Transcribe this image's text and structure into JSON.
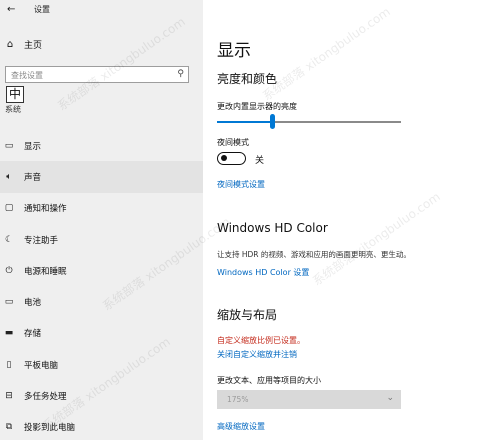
{
  "window": {
    "title": "设置",
    "back_icon": "back-arrow-icon"
  },
  "sidebar": {
    "home_label": "主页",
    "search_placeholder": "查找设置",
    "ime_indicator": "中",
    "section_caption": "系统",
    "items": [
      {
        "label": "显示",
        "icon": "monitor-icon"
      },
      {
        "label": "声音",
        "icon": "speaker-icon",
        "selected": true
      },
      {
        "label": "通知和操作",
        "icon": "notification-icon"
      },
      {
        "label": "专注助手",
        "icon": "moon-icon"
      },
      {
        "label": "电源和睡眠",
        "icon": "power-icon"
      },
      {
        "label": "电池",
        "icon": "battery-icon"
      },
      {
        "label": "存储",
        "icon": "storage-icon"
      },
      {
        "label": "平板电脑",
        "icon": "tablet-icon"
      },
      {
        "label": "多任务处理",
        "icon": "multitask-icon"
      },
      {
        "label": "投影到此电脑",
        "icon": "project-icon"
      }
    ]
  },
  "main": {
    "title": "显示",
    "brightness_section": "亮度和颜色",
    "brightness_label": "更改内置显示器的亮度",
    "brightness_level": 0.3,
    "night_label": "夜间模式",
    "night_toggle_state": "关",
    "night_settings_link": "夜间模式设置",
    "hdr_title": "Windows HD Color",
    "hdr_desc": "让支持 HDR 的视频、游戏和应用的画面更明亮、更生动。",
    "hdr_link": "Windows HD Color 设置",
    "scale_section": "缩放与布局",
    "custom_scale_warning": "自定义缩放比例已设置。",
    "turn_off_custom_link": "关闭自定义缩放并注销",
    "text_size_label": "更改文本、应用等项目的大小",
    "text_size_value": "175%",
    "advanced_scaling_link": "高级缩放设置"
  },
  "watermark": "系统部落 xitongbuluo.com",
  "colors": {
    "accent": "#0078d4",
    "link": "#0067c0",
    "warning": "#c42b1c",
    "sidebar_bg": "#efefef",
    "selected_bg": "#e3e3e3"
  }
}
